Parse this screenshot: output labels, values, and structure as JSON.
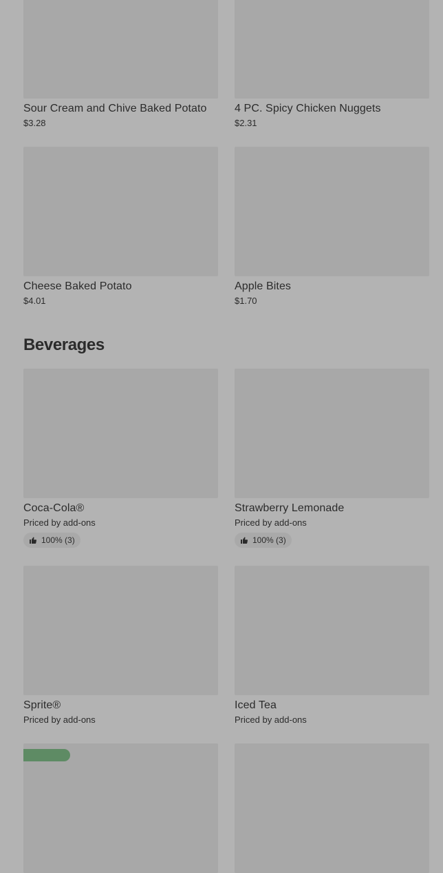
{
  "sides": [
    {
      "name": "Sour Cream and Chive Baked Potato",
      "price": "$3.28"
    },
    {
      "name": "4 PC. Spicy Chicken Nuggets",
      "price": "$2.31"
    },
    {
      "name": "Cheese Baked Potato",
      "price": "$4.01"
    },
    {
      "name": "Apple Bites",
      "price": "$1.70"
    }
  ],
  "beverages": {
    "title": "Beverages",
    "items": [
      {
        "name": "Coca-Cola®",
        "price": "Priced by add-ons",
        "rating": "100% (3)"
      },
      {
        "name": "Strawberry Lemonade",
        "price": "Priced by add-ons",
        "rating": "100% (3)"
      },
      {
        "name": "Sprite®",
        "price": "Priced by add-ons"
      },
      {
        "name": "Iced Tea",
        "price": "Priced by add-ons"
      }
    ]
  },
  "icons": {
    "rating": "thumbs-up-icon"
  }
}
